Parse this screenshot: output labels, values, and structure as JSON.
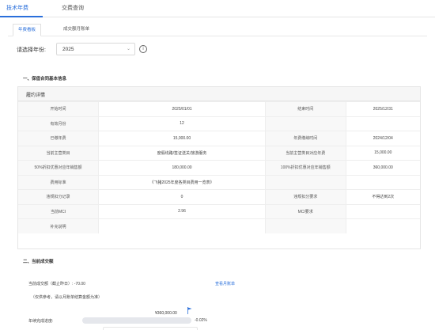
{
  "top_tabs": [
    {
      "label": "技术年费",
      "active": true
    },
    {
      "label": "交费查询",
      "active": false
    }
  ],
  "sub_tabs": [
    {
      "label": "年费看板",
      "active": true
    },
    {
      "label": "成交额月账单",
      "active": false
    }
  ],
  "year_filter": {
    "label": "请选择年份:",
    "value": "2025",
    "chevron_icon": "chevron-down-icon",
    "info_icon": "info-circle-icon"
  },
  "section1": {
    "title": "一、保值合同基本信息"
  },
  "contract": {
    "header": "履约详情",
    "rows": [
      [
        "开始时间",
        "2025/01/01",
        "结束时间",
        "2025/12/31"
      ],
      [
        "有效月份",
        "12",
        "",
        ""
      ],
      [
        "已缴年费",
        "15,000.00",
        "年费缴纳时间",
        "2024/12/04"
      ],
      [
        "当前主营类目",
        "度假线路/签证送关/旅游服务",
        "当前主营类目对应年费",
        "15,000.00"
      ],
      [
        "50%折扣优惠对应年销售额",
        "180,000.00",
        "100%折扣优惠对应年销售额",
        "360,000.00"
      ],
      [
        "费用标准",
        "《飞猪2025年度各类目费用一览表》",
        "",
        ""
      ],
      [
        "违规扣分记录",
        "0",
        "违规扣分要求",
        "不得达到2次"
      ],
      [
        "当前MCI",
        "2.96",
        "MCI要求",
        ""
      ],
      [
        "补充说明",
        "",
        "",
        ""
      ]
    ]
  },
  "section2": {
    "title": "二、当前成交额"
  },
  "deal": {
    "amount_text": "当前成交额（截止昨日）: -70.00",
    "link_text": "查看月账单",
    "note": "（仅供参考，请以月账单结算金额为准）"
  },
  "progress": {
    "label": "年续完成进度:",
    "target": "¥360,000.00",
    "percent_text": "-0.02%",
    "fill_fraction": 0,
    "flag_icon": "flag-icon"
  },
  "colors": {
    "accent": "#2a6fdb"
  }
}
